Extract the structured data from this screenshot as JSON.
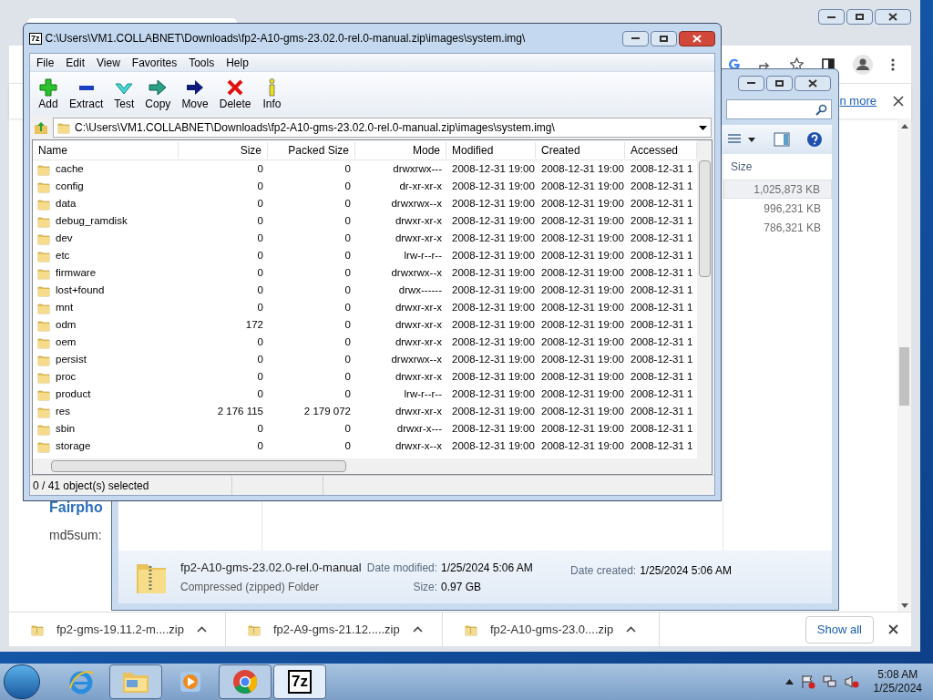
{
  "chrome": {
    "link_text": "n more",
    "page_heading": "Fairpho",
    "page_text": "md5sum:",
    "downloads": [
      {
        "name": "fp2-gms-19.11.2-m....zip"
      },
      {
        "name": "fp2-A9-gms-21.12.....zip"
      },
      {
        "name": "fp2-A10-gms-23.0....zip"
      }
    ],
    "show_all": "Show all"
  },
  "explorer": {
    "size_column": "Size",
    "files": [
      {
        "size": "1,025,873 KB",
        "selected": true
      },
      {
        "size": "996,231 KB",
        "selected": false
      },
      {
        "size": "786,321 KB",
        "selected": false
      }
    ],
    "details": {
      "name": "fp2-A10-gms-23.02.0-rel.0-manual",
      "type": "Compressed (zipped) Folder",
      "modified_label": "Date modified:",
      "modified": "1/25/2024 5:06 AM",
      "size_label": "Size:",
      "size": "0.97 GB",
      "created_label": "Date created:",
      "created": "1/25/2024 5:06 AM"
    }
  },
  "sevenzip": {
    "icon_text": "7z",
    "title": "C:\\Users\\VM1.COLLABNET\\Downloads\\fp2-A10-gms-23.02.0-rel.0-manual.zip\\images\\system.img\\",
    "menu": [
      "File",
      "Edit",
      "View",
      "Favorites",
      "Tools",
      "Help"
    ],
    "toolbar": [
      {
        "label": "Add",
        "kind": "add"
      },
      {
        "label": "Extract",
        "kind": "extract"
      },
      {
        "label": "Test",
        "kind": "test"
      },
      {
        "label": "Copy",
        "kind": "copy"
      },
      {
        "label": "Move",
        "kind": "move"
      },
      {
        "label": "Delete",
        "kind": "delete"
      },
      {
        "label": "Info",
        "kind": "info"
      }
    ],
    "address": "C:\\Users\\VM1.COLLABNET\\Downloads\\fp2-A10-gms-23.02.0-rel.0-manual.zip\\images\\system.img\\",
    "columns": [
      "Name",
      "Size",
      "Packed Size",
      "Mode",
      "Modified",
      "Created",
      "Accessed"
    ],
    "rows": [
      [
        "cache",
        "0",
        "0",
        "drwxrwx---",
        "2008-12-31 19:00",
        "2008-12-31 19:00",
        "2008-12-31 1"
      ],
      [
        "config",
        "0",
        "0",
        "dr-xr-xr-x",
        "2008-12-31 19:00",
        "2008-12-31 19:00",
        "2008-12-31 1"
      ],
      [
        "data",
        "0",
        "0",
        "drwxrwx--x",
        "2008-12-31 19:00",
        "2008-12-31 19:00",
        "2008-12-31 1"
      ],
      [
        "debug_ramdisk",
        "0",
        "0",
        "drwxr-xr-x",
        "2008-12-31 19:00",
        "2008-12-31 19:00",
        "2008-12-31 1"
      ],
      [
        "dev",
        "0",
        "0",
        "drwxr-xr-x",
        "2008-12-31 19:00",
        "2008-12-31 19:00",
        "2008-12-31 1"
      ],
      [
        "etc",
        "0",
        "0",
        "lrw-r--r--",
        "2008-12-31 19:00",
        "2008-12-31 19:00",
        "2008-12-31 1"
      ],
      [
        "firmware",
        "0",
        "0",
        "drwxrwx--x",
        "2008-12-31 19:00",
        "2008-12-31 19:00",
        "2008-12-31 1"
      ],
      [
        "lost+found",
        "0",
        "0",
        "drwx------",
        "2008-12-31 19:00",
        "2008-12-31 19:00",
        "2008-12-31 1"
      ],
      [
        "mnt",
        "0",
        "0",
        "drwxr-xr-x",
        "2008-12-31 19:00",
        "2008-12-31 19:00",
        "2008-12-31 1"
      ],
      [
        "odm",
        "172",
        "0",
        "drwxr-xr-x",
        "2008-12-31 19:00",
        "2008-12-31 19:00",
        "2008-12-31 1"
      ],
      [
        "oem",
        "0",
        "0",
        "drwxr-xr-x",
        "2008-12-31 19:00",
        "2008-12-31 19:00",
        "2008-12-31 1"
      ],
      [
        "persist",
        "0",
        "0",
        "drwxrwx--x",
        "2008-12-31 19:00",
        "2008-12-31 19:00",
        "2008-12-31 1"
      ],
      [
        "proc",
        "0",
        "0",
        "drwxr-xr-x",
        "2008-12-31 19:00",
        "2008-12-31 19:00",
        "2008-12-31 1"
      ],
      [
        "product",
        "0",
        "0",
        "lrw-r--r--",
        "2008-12-31 19:00",
        "2008-12-31 19:00",
        "2008-12-31 1"
      ],
      [
        "res",
        "2 176 115",
        "2 179 072",
        "drwxr-xr-x",
        "2008-12-31 19:00",
        "2008-12-31 19:00",
        "2008-12-31 1"
      ],
      [
        "sbin",
        "0",
        "0",
        "drwxr-x---",
        "2008-12-31 19:00",
        "2008-12-31 19:00",
        "2008-12-31 1"
      ],
      [
        "storage",
        "0",
        "0",
        "drwxr-x--x",
        "2008-12-31 19:00",
        "2008-12-31 19:00",
        "2008-12-31 1"
      ]
    ],
    "status": "0 / 41 object(s) selected"
  },
  "taskbar": {
    "apps": [
      {
        "kind": "ie",
        "running": false,
        "selected": false
      },
      {
        "kind": "explorer",
        "running": true,
        "selected": false
      },
      {
        "kind": "media",
        "running": false,
        "selected": false
      },
      {
        "kind": "chrome",
        "running": true,
        "selected": false
      },
      {
        "kind": "sevenzip",
        "running": true,
        "selected": true,
        "label": "7z"
      }
    ],
    "time": "5:08 AM",
    "date": "1/25/2024"
  }
}
